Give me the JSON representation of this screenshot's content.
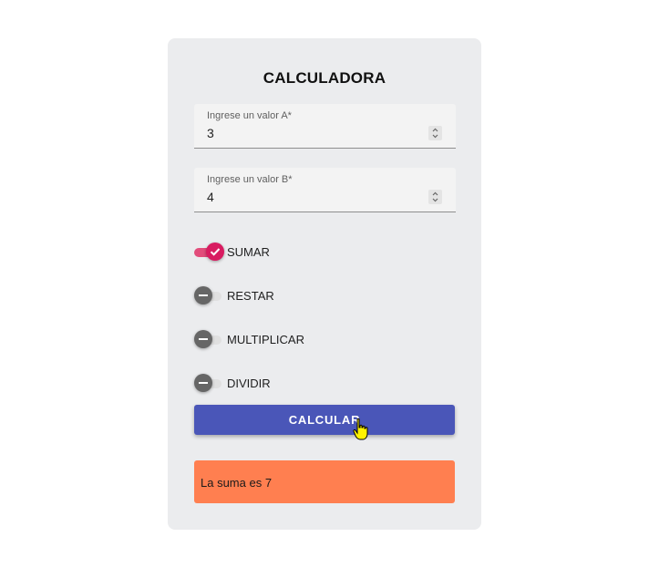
{
  "calculator": {
    "title": "CALCULADORA",
    "field_a": {
      "label": "Ingrese un valor A*",
      "value": "3"
    },
    "field_b": {
      "label": "Ingrese un valor B*",
      "value": "4"
    },
    "operations": [
      {
        "label": "SUMAR",
        "checked": true
      },
      {
        "label": "RESTAR",
        "checked": false
      },
      {
        "label": "MULTIPLICAR",
        "checked": false
      },
      {
        "label": "DIVIDIR",
        "checked": false
      }
    ],
    "calculate_label": "CALCULAR",
    "result_text": "La suma es 7"
  },
  "colors": {
    "card_bg": "#ebecee",
    "switch_on": "#d81b60",
    "switch_off": "#666666",
    "button": "#4a56b8",
    "result_bg": "#ff7f50"
  },
  "icons": [
    "check-icon",
    "minus-icon",
    "spinner-icon",
    "hand-pointer-icon"
  ]
}
